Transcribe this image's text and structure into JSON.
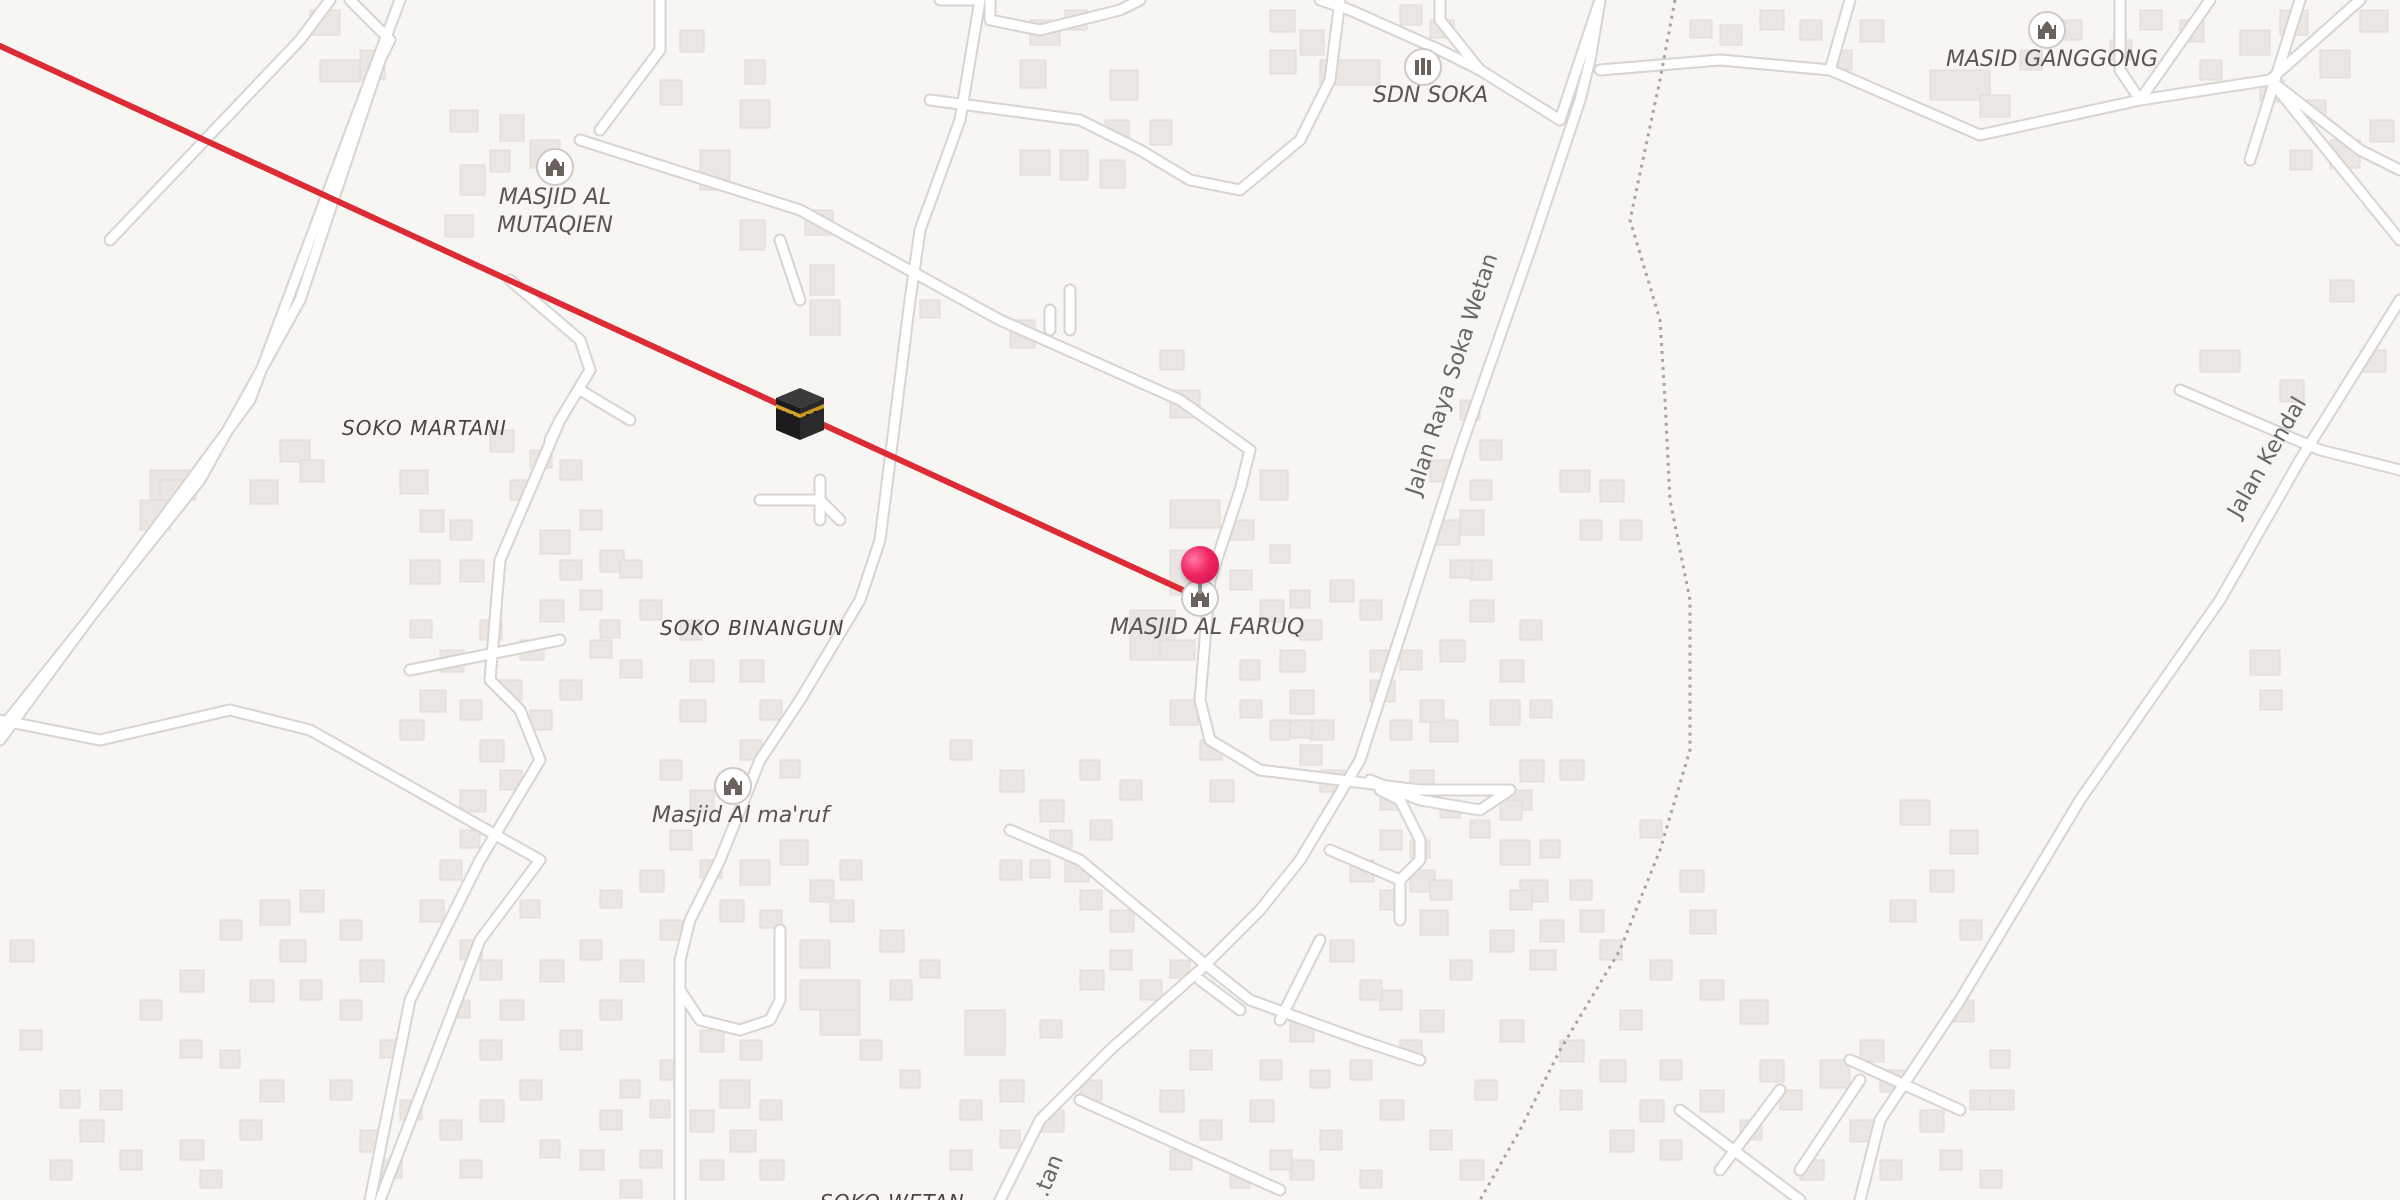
{
  "map": {
    "type": "qibla-direction-map",
    "direction_line_color": "#dc2b35",
    "marker_color": "#f0245f",
    "background_color": "#f8f6f3",
    "road_color": "#ffffff",
    "road_casing_color": "#d8d4d0",
    "building_color": "#ebe6e2",
    "icons": {
      "kaaba": "kaaba-icon",
      "location": "location-pin-icon",
      "mosque": "mosque-icon",
      "school": "school-icon"
    }
  },
  "pois": {
    "masjid_al_mutaqien": "MASJID AL MUTAQIEN",
    "sdn_soka": "SDN SOKA",
    "masid_ganggong": "MASID GANGGONG",
    "masjid_al_faruq": "MASJID AL FARUQ",
    "masjid_al_maruf": "Masjid Al ma'ruf"
  },
  "places": {
    "soko_martani": "SOKO MARTANI",
    "soko_binangun": "SOKO BINANGUN",
    "soko_wetan": "SOKO WETAN"
  },
  "roads": {
    "jalan_raya_soka_wetan": "Jalan Raya Soka Wetan",
    "jalan_kendal": "Jalan Kendal",
    "bottom_road": "...tan"
  }
}
